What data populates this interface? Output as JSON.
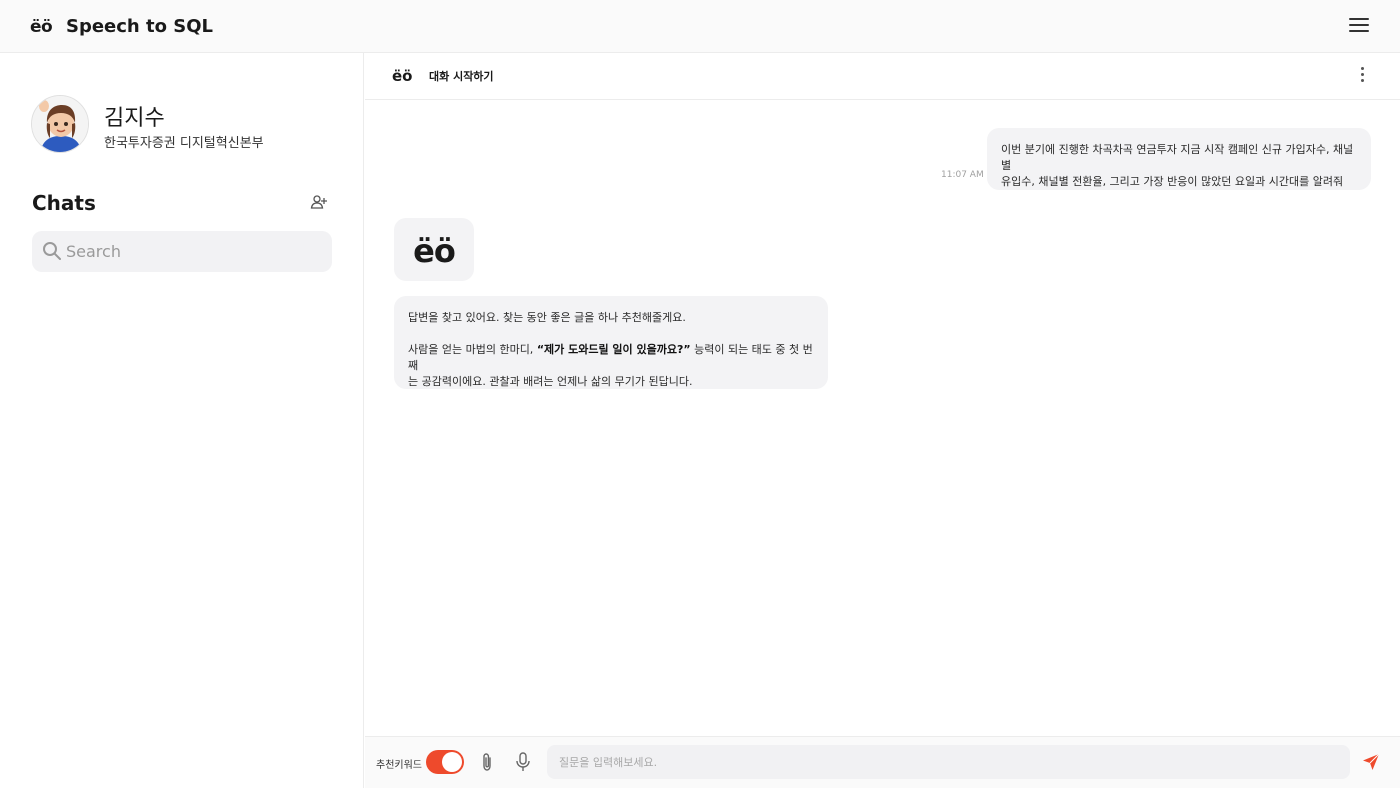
{
  "app": {
    "logo_text": "ëö",
    "title": "Speech to SQL"
  },
  "profile": {
    "name": "김지수",
    "department": "한국투자증권 디지털혁신본부"
  },
  "sidebar": {
    "chats_title": "Chats",
    "search_placeholder": "Search"
  },
  "chat": {
    "logo_text": "ëö",
    "title": "대화 시작하기",
    "messages": {
      "user": {
        "time": "11:07 AM",
        "line1": "이번 분기에 진행한 차곡차곡 연금투자 지금 시작 캠페인 신규 가입자수, 채널별",
        "line2": "유입수, 채널별 전환율, 그리고 가장 반응이 많았던 요일과 시간대를 알려줘"
      },
      "bot_avatar_text": "ëö",
      "bot": {
        "line1": "답변을 찾고 있어요. 찾는 동안 좋은 글을 하나 추천해줄게요.",
        "line2_prefix": "사람을 얻는 마법의 한마디, ",
        "line2_bold": "“제가 도와드릴 일이 있을까요?”",
        "line2_suffix": " 능력이 되는 태도 중 첫 번째",
        "line3": "는 공감력이에요. 관찰과 배려는 언제나 삶의 무기가 된답니다."
      }
    }
  },
  "composer": {
    "keyword_label": "추천키워드",
    "keyword_toggle_on": true,
    "input_placeholder": "질문을 입력해보세요.",
    "accent_color": "#ee4a2c"
  },
  "icons": {
    "menu": "hamburger-menu-icon",
    "add_user": "add-user-icon",
    "search": "search-icon",
    "more": "more-vertical-icon",
    "attach": "paperclip-icon",
    "mic": "microphone-icon",
    "send": "send-icon"
  }
}
